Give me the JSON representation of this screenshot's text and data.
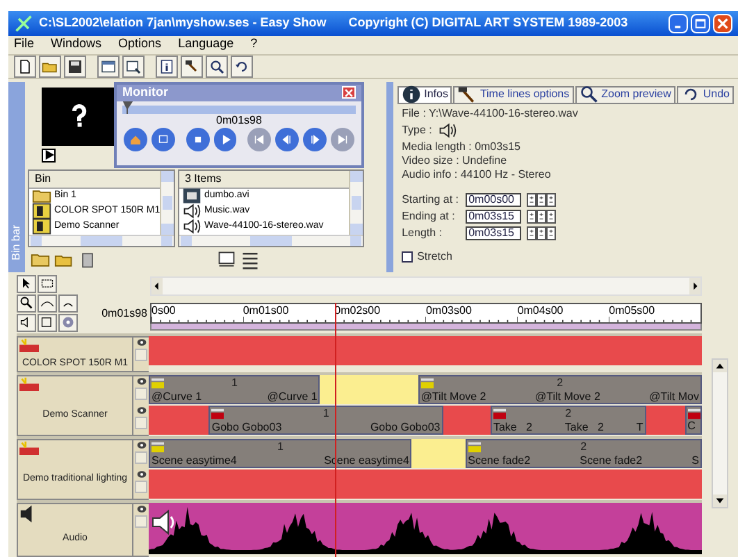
{
  "window": {
    "title": "C:\\SL2002\\elation 7jan\\myshow.ses - Easy Show",
    "copyright": "Copyright (C) DIGITAL ART SYSTEM 1989-2003"
  },
  "menu": [
    "File",
    "Windows",
    "Options",
    "Language",
    "?"
  ],
  "monitor": {
    "title": "Monitor",
    "time": "0m01s98",
    "level": 0.0
  },
  "bin": {
    "bar_label": "Bin bar",
    "header": "Bin",
    "items": [
      {
        "label": "Bin 1",
        "kind": "folder"
      },
      {
        "label": "COLOR SPOT 150R M1",
        "kind": "fixture"
      },
      {
        "label": "Demo Scanner",
        "kind": "fixture"
      }
    ]
  },
  "media": {
    "header": "3 Items",
    "items": [
      {
        "label": "dumbo.avi",
        "kind": "video"
      },
      {
        "label": "Music.wav",
        "kind": "audio"
      },
      {
        "label": "Wave-44100-16-stereo.wav",
        "kind": "audio"
      }
    ]
  },
  "info": {
    "tabs": [
      {
        "label": "Infos",
        "selected": true
      },
      {
        "label": "Time lines options",
        "selected": false
      },
      {
        "label": "Zoom preview",
        "selected": false
      },
      {
        "label": "Undo",
        "selected": false
      }
    ],
    "file": "File : Y:\\Wave-44100-16-stereo.wav",
    "type_label": "Type :",
    "lines": [
      "Media length : 0m03s15",
      "Video size : Undefine",
      "Audio info : 44100 Hz - Stereo"
    ],
    "fields": [
      {
        "label": "Starting at :",
        "value": "0m00s00"
      },
      {
        "label": "Ending at :",
        "value": "0m03s15"
      },
      {
        "label": "Length :",
        "value": "0m03s15"
      }
    ],
    "stretch": {
      "label": "Stretch",
      "checked": false
    }
  },
  "timeline": {
    "time": "0m01s98",
    "ruler": [
      "0s00",
      "0m01s00",
      "0m02s00",
      "0m03s00",
      "0m04s00",
      "0m05s00"
    ],
    "tracks": [
      {
        "name": "COLOR SPOT 150R M1",
        "kind": "light",
        "lanes": [
          {
            "checked": false,
            "segments": [
              {
                "kind": "empty"
              }
            ]
          }
        ]
      },
      {
        "name": "Demo Scanner",
        "kind": "light",
        "lanes": [
          {
            "checked": false,
            "segments": [
              {
                "kind": "clip",
                "number": "1",
                "color": "#e0d000",
                "labels": [
                  "@Curve 1",
                  "@Curve 1"
                ]
              },
              {
                "kind": "transition"
              },
              {
                "kind": "clip",
                "number": "2",
                "color": "#e0d000",
                "labels": [
                  "@Tilt Move 2",
                  "@Tilt Move 2",
                  "@Tilt Mov"
                ]
              }
            ]
          },
          {
            "checked": false,
            "segments": [
              {
                "kind": "empty"
              },
              {
                "kind": "clip",
                "number": "1",
                "color": "#c00010",
                "labels": [
                  "Gobo Gobo03",
                  "Gobo Gobo03"
                ]
              },
              {
                "kind": "empty"
              },
              {
                "kind": "clip",
                "number": "2",
                "color": "#c00010",
                "labels": [
                  "Take   2",
                  "Take   2",
                  "T"
                ]
              },
              {
                "kind": "empty"
              },
              {
                "kind": "clip",
                "color": "#c00010",
                "labels": [
                  "C"
                ]
              }
            ]
          }
        ]
      },
      {
        "name": "Demo traditional lighting",
        "kind": "light",
        "lanes": [
          {
            "checked": false,
            "segments": [
              {
                "kind": "clip",
                "number": "1",
                "color": "#e0d000",
                "labels": [
                  "Scene easytime4",
                  "Scene easytime4"
                ]
              },
              {
                "kind": "transition"
              },
              {
                "kind": "clip",
                "number": "2",
                "color": "#e0d000",
                "labels": [
                  "Scene fade2",
                  "Scene fade2",
                  "S"
                ]
              }
            ]
          },
          {
            "checked": false,
            "segments": [
              {
                "kind": "empty"
              }
            ]
          }
        ]
      },
      {
        "name": "Audio",
        "kind": "audio",
        "lanes": [
          {
            "checked": false,
            "segments": [
              {
                "kind": "audio"
              }
            ]
          }
        ]
      }
    ]
  }
}
